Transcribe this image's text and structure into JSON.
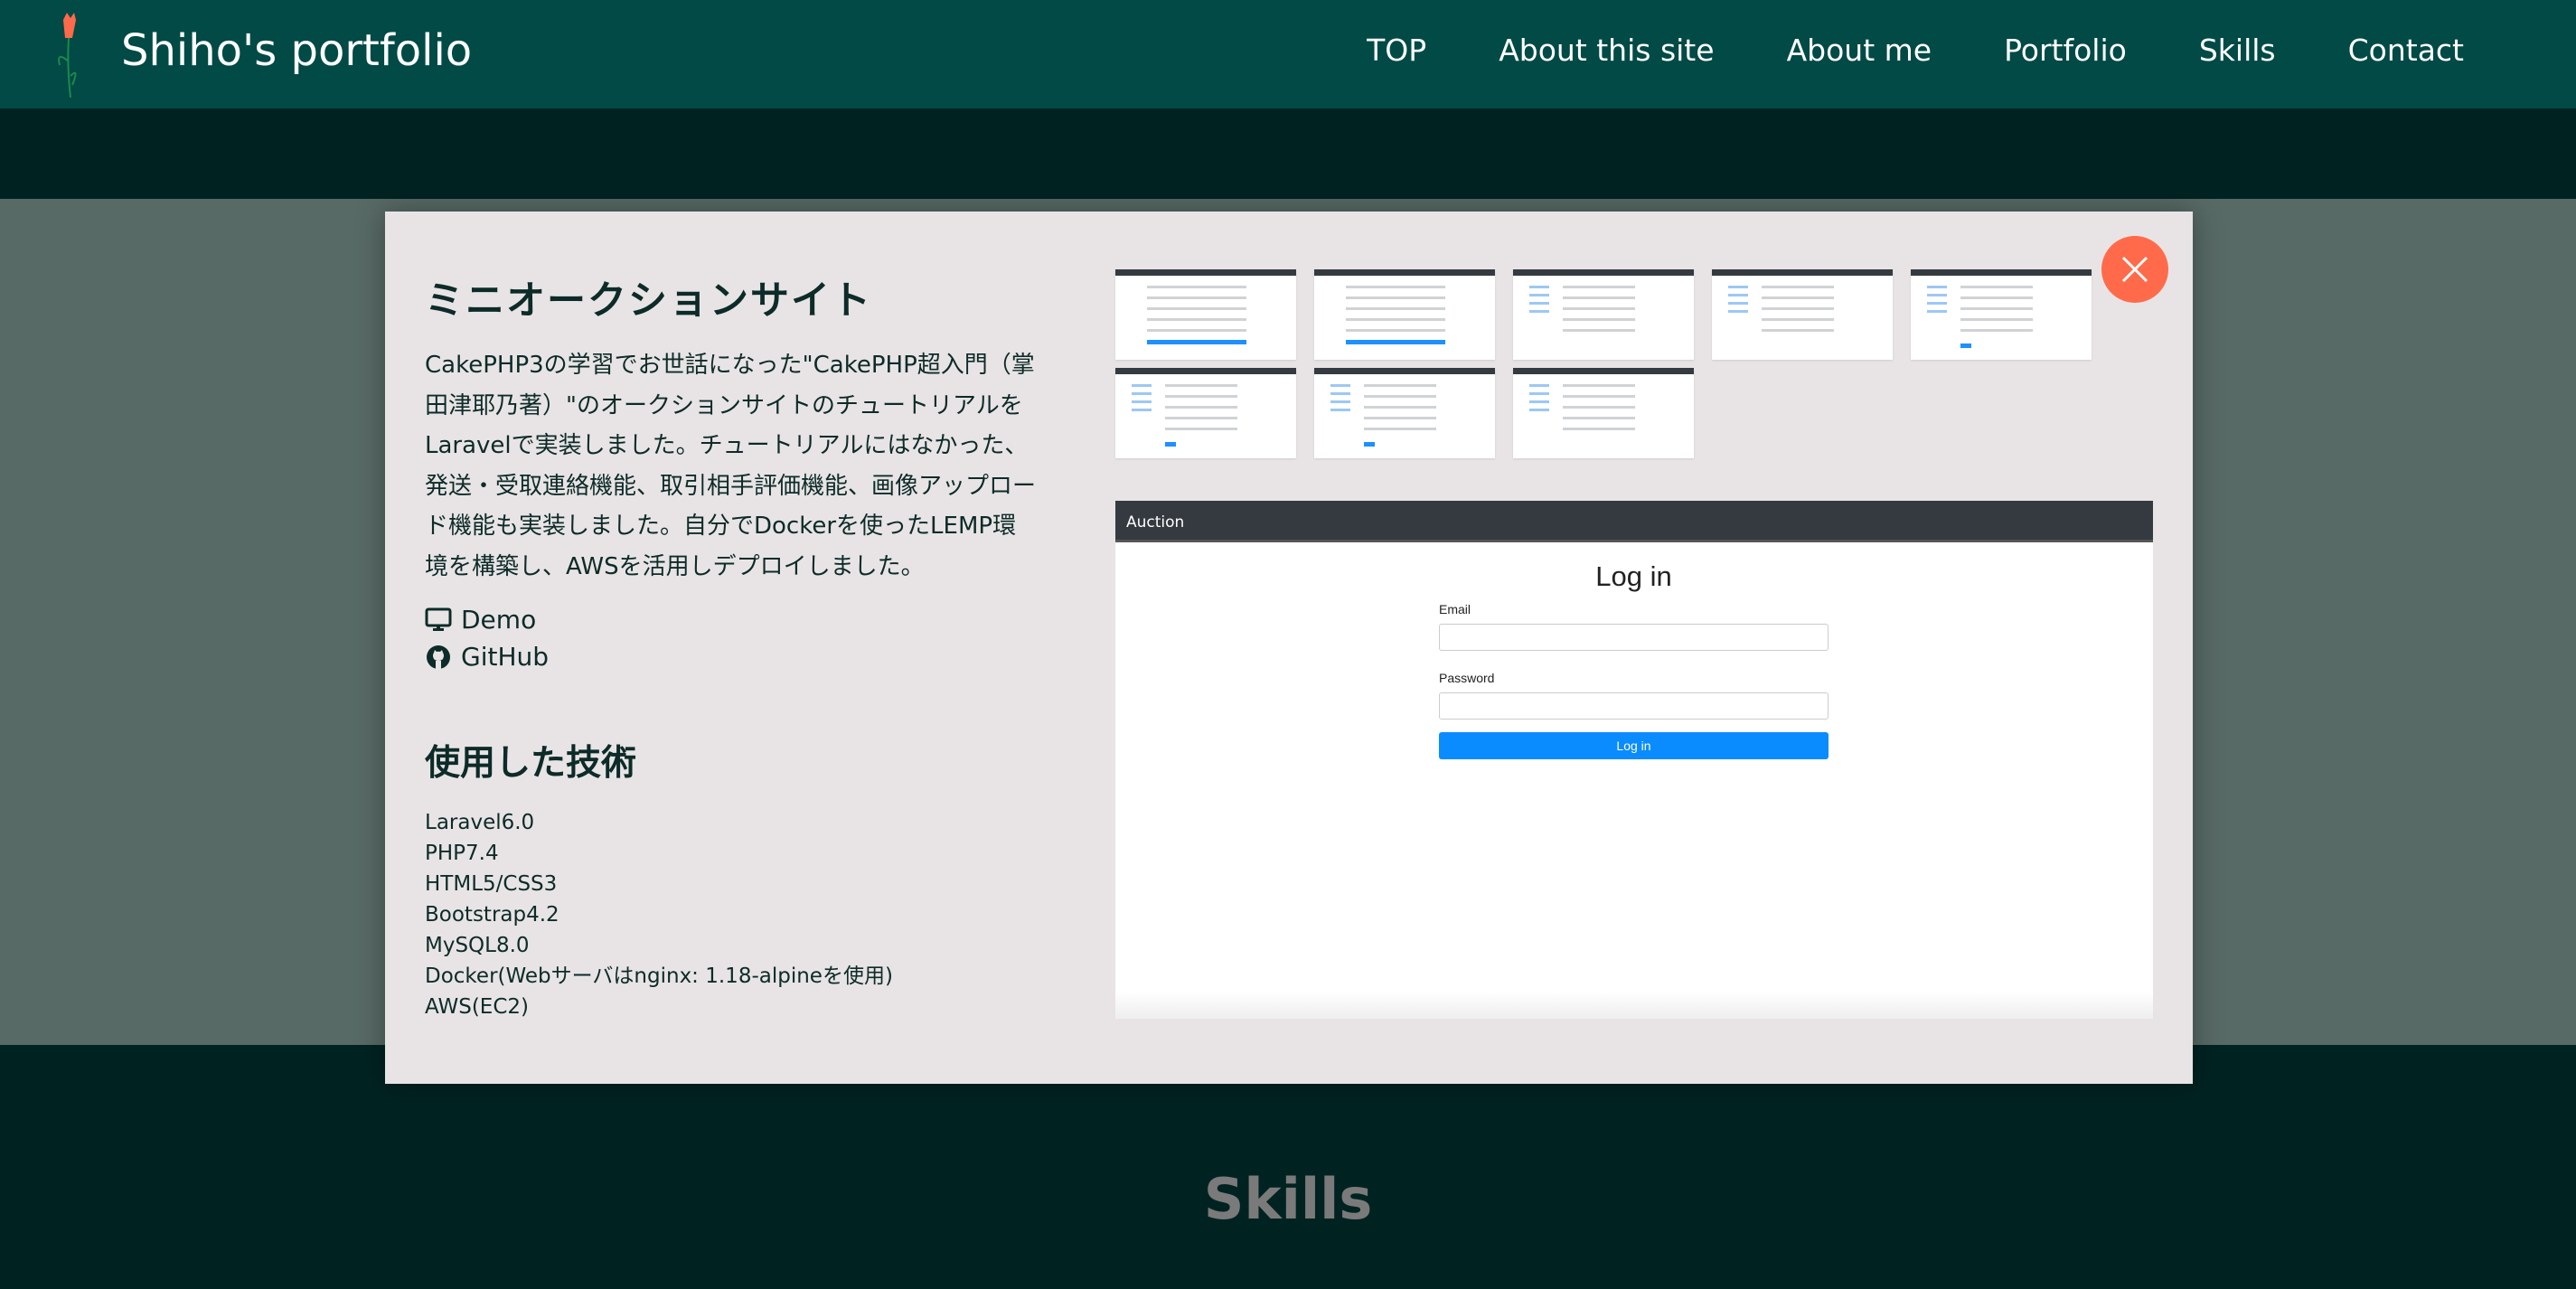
{
  "header": {
    "brand": "Shiho's portfolio",
    "nav": [
      "TOP",
      "About this site",
      "About me",
      "Portfolio",
      "Skills",
      "Contact"
    ]
  },
  "modal": {
    "title": "ミニオークションサイト",
    "description": "CakePHP3の学習でお世話になった\"CakePHP超入門（掌田津耶乃著）\"のオークションサイトのチュートリアルをLaravelで実装しました。チュートリアルにはなかった、発送・受取連絡機能、取引相手評価機能、画像アップロード機能も実装しました。自分でDockerを使ったLEMP環境を構築し、AWSを活用しデプロイしました。",
    "links": {
      "demo": "Demo",
      "github": "GitHub"
    },
    "tech_heading": "使用した技術",
    "tech": [
      "Laravel6.0",
      "PHP7.4",
      "HTML5/CSS3",
      "Bootstrap4.2",
      "MySQL8.0",
      "Docker(Webサーバはnginx: 1.18-alpineを使用)",
      "AWS(EC2)"
    ],
    "preview": {
      "navbar_brand": "Auction",
      "title": "Log in",
      "email_label": "Email",
      "password_label": "Password",
      "button": "Log in"
    }
  },
  "section_title": "Skills",
  "colors": {
    "header": "#014a46",
    "accent": "#ff6b4a",
    "button": "#0a8cff",
    "background": "#002322"
  }
}
